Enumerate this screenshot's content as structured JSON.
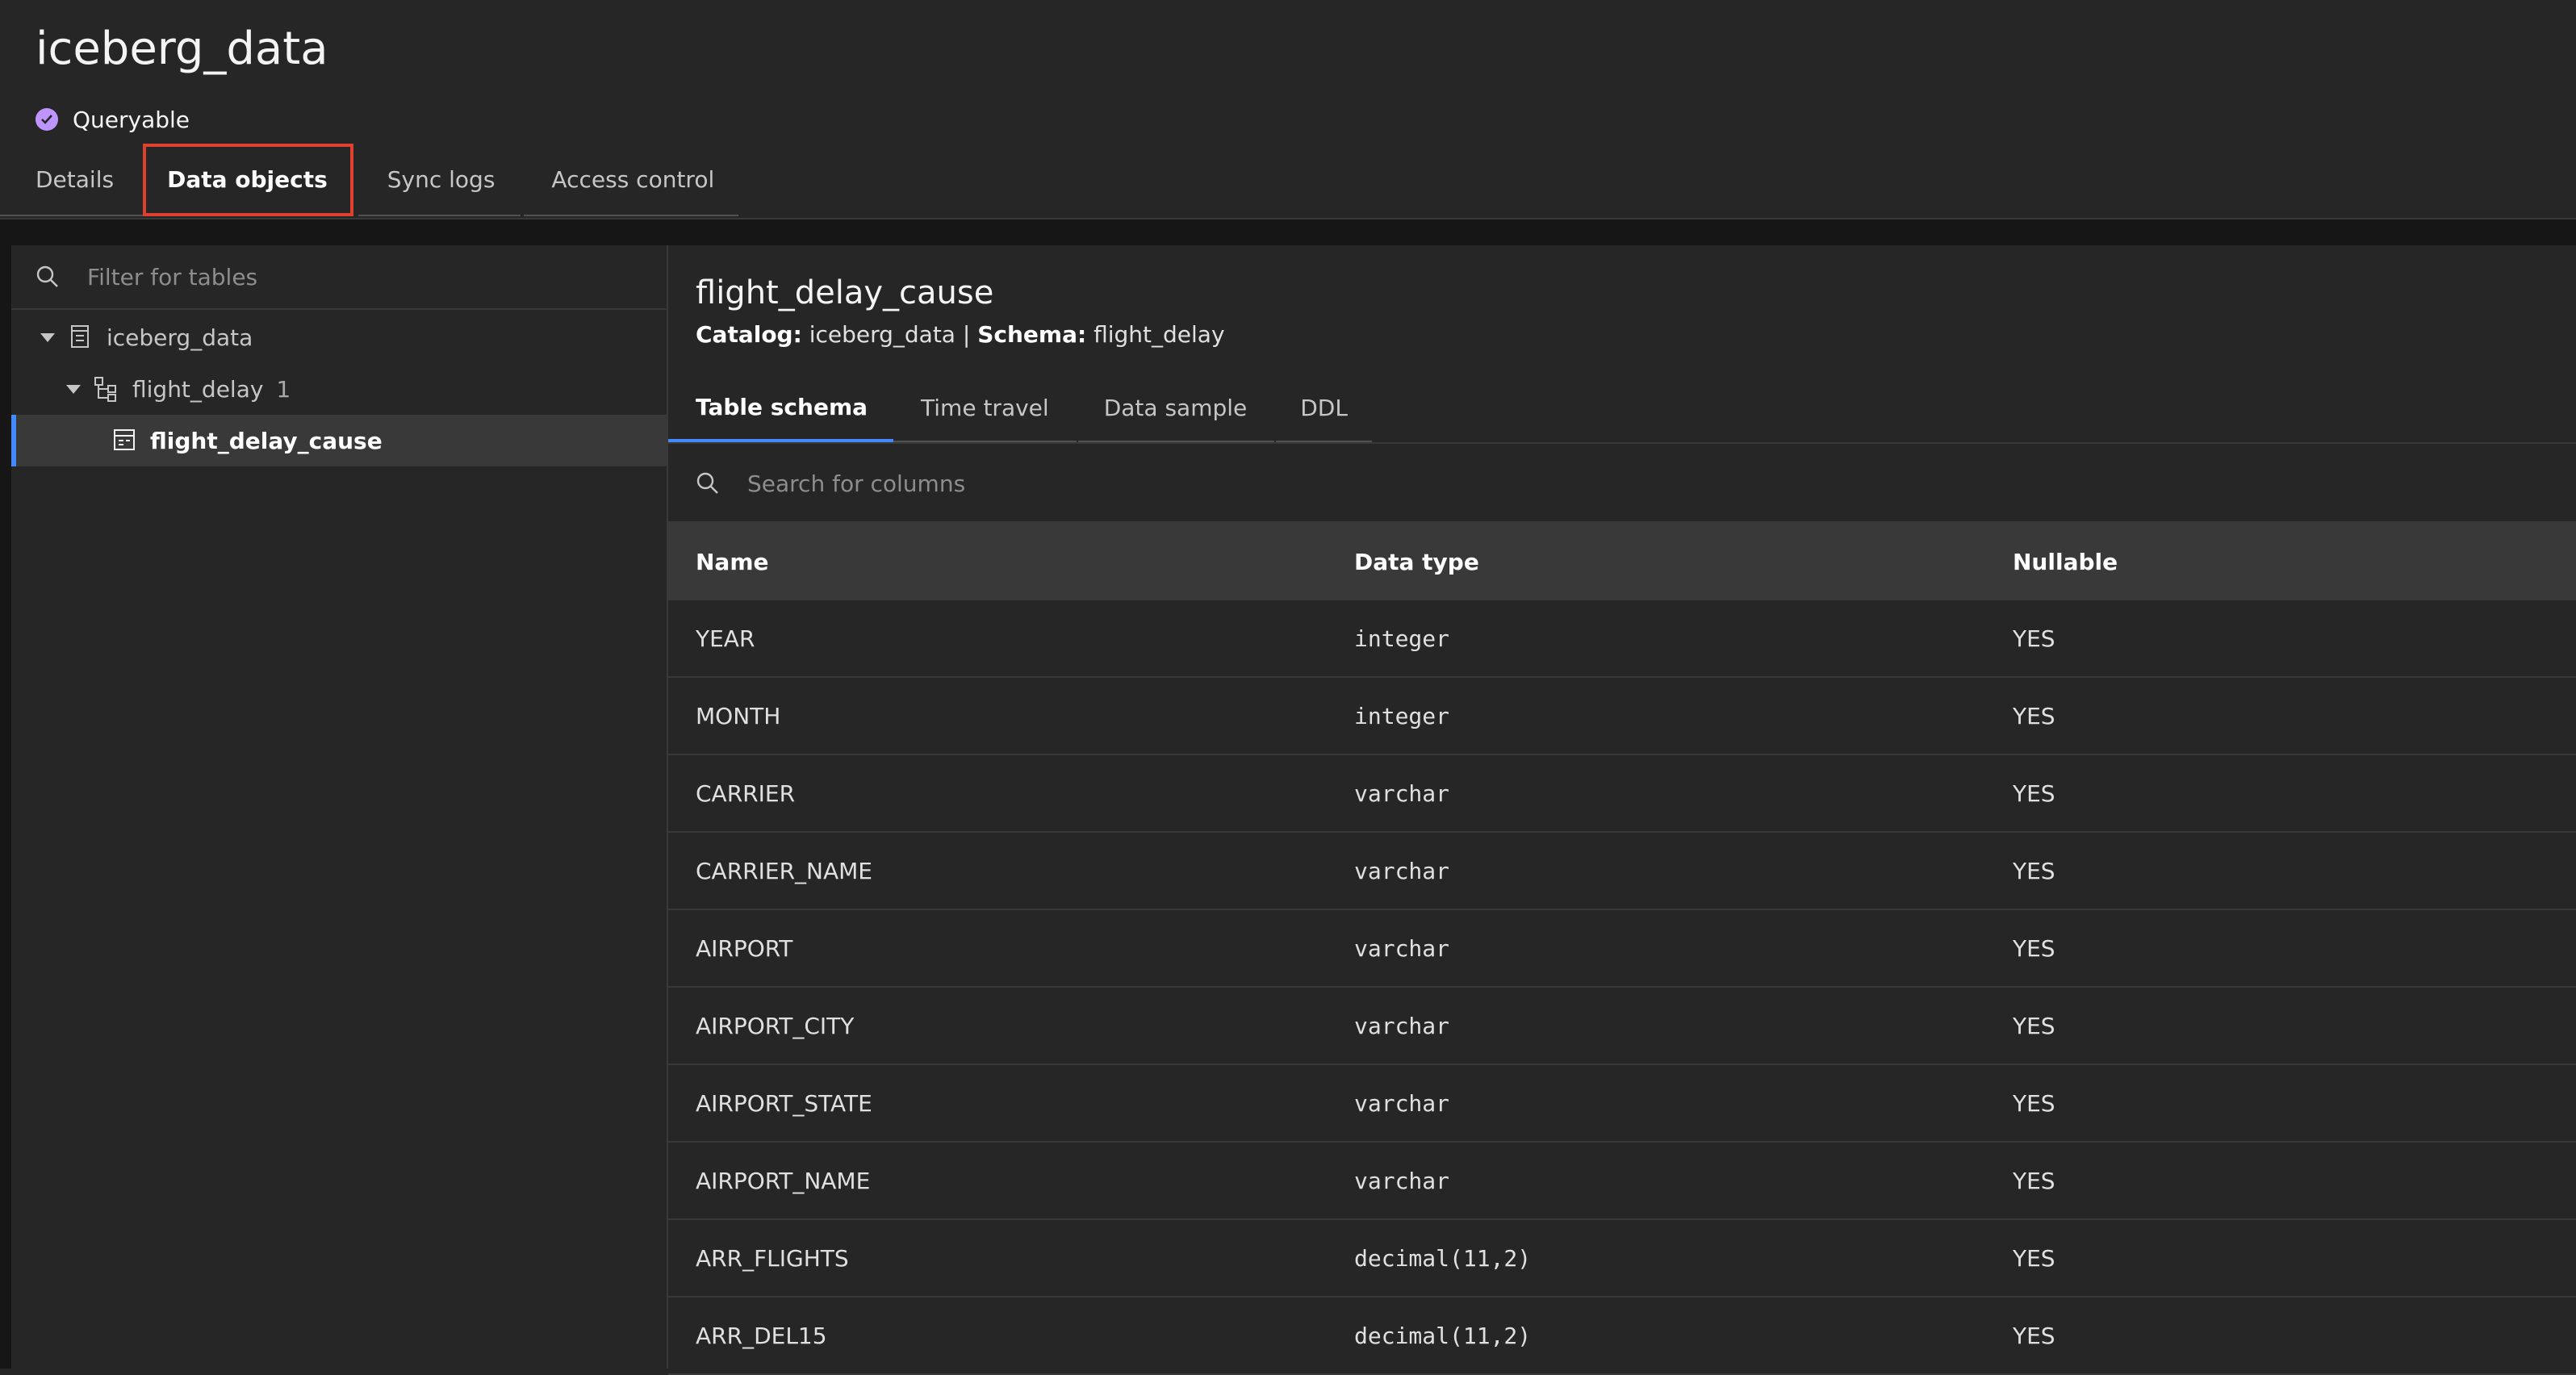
{
  "header": {
    "title": "iceberg_data",
    "status": "Queryable",
    "tabs": [
      {
        "label": "Details"
      },
      {
        "label": "Data objects"
      },
      {
        "label": "Sync logs"
      },
      {
        "label": "Access control"
      }
    ],
    "active_tab": "Data objects"
  },
  "sidebar": {
    "filter_placeholder": "Filter for tables",
    "tree": {
      "catalog": "iceberg_data",
      "schema": "flight_delay",
      "schema_count": "1",
      "table": "flight_delay_cause"
    }
  },
  "main": {
    "table_title": "flight_delay_cause",
    "crumbs": {
      "catalog_label": "Catalog:",
      "catalog_value": "iceberg_data",
      "separator": "|",
      "schema_label": "Schema:",
      "schema_value": "flight_delay"
    },
    "tabs": [
      {
        "label": "Table schema"
      },
      {
        "label": "Time travel"
      },
      {
        "label": "Data sample"
      },
      {
        "label": "DDL"
      }
    ],
    "active_tab": "Table schema",
    "column_search_placeholder": "Search for columns",
    "columns": {
      "name": "Name",
      "data_type": "Data type",
      "nullable": "Nullable"
    },
    "rows": [
      {
        "name": "YEAR",
        "type": "integer",
        "nullable": "YES"
      },
      {
        "name": "MONTH",
        "type": "integer",
        "nullable": "YES"
      },
      {
        "name": "CARRIER",
        "type": "varchar",
        "nullable": "YES"
      },
      {
        "name": "CARRIER_NAME",
        "type": "varchar",
        "nullable": "YES"
      },
      {
        "name": "AIRPORT",
        "type": "varchar",
        "nullable": "YES"
      },
      {
        "name": "AIRPORT_CITY",
        "type": "varchar",
        "nullable": "YES"
      },
      {
        "name": "AIRPORT_STATE",
        "type": "varchar",
        "nullable": "YES"
      },
      {
        "name": "AIRPORT_NAME",
        "type": "varchar",
        "nullable": "YES"
      },
      {
        "name": "ARR_FLIGHTS",
        "type": "decimal(11,2)",
        "nullable": "YES"
      },
      {
        "name": "ARR_DEL15",
        "type": "decimal(11,2)",
        "nullable": "YES"
      }
    ]
  },
  "colors": {
    "background": "#262626",
    "accent": "#4589ff",
    "status": "#be95ff",
    "highlight": "#e0412f"
  }
}
